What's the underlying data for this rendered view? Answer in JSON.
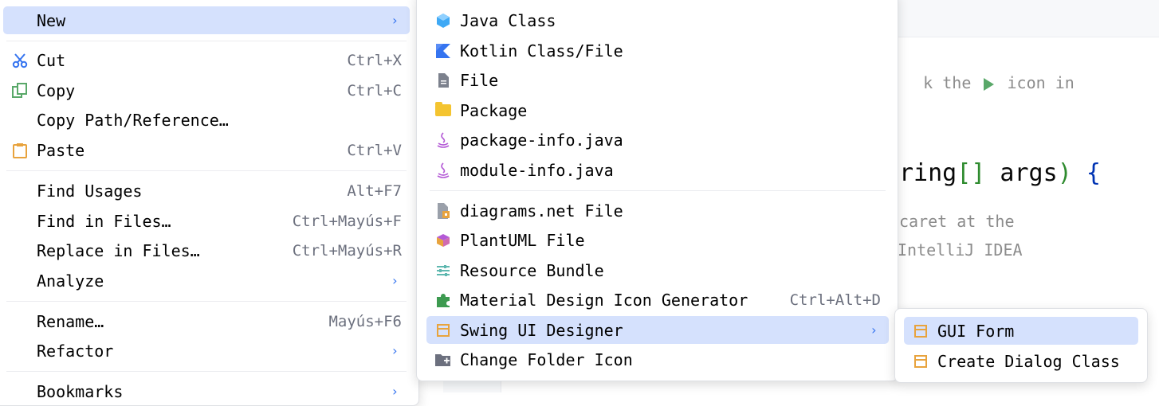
{
  "editor": {
    "line1_left": "k the",
    "line1_right": "icon in",
    "line2_text": "ring",
    "line2_brackets": "[]",
    "line2_args": " args",
    "line2_paren": ")",
    "line2_brace": "{",
    "line3": "caret at the",
    "line4": "IntelliJ IDEA",
    "right_paren": ")"
  },
  "main_menu": {
    "items": [
      {
        "label": "New",
        "shortcut": "",
        "has_submenu": true,
        "selected": true
      },
      {
        "label": "Cut",
        "shortcut": "Ctrl+X",
        "icon": "scissors-icon"
      },
      {
        "label": "Copy",
        "shortcut": "Ctrl+C",
        "icon": "copy-icon"
      },
      {
        "label": "Copy Path/Reference…",
        "shortcut": ""
      },
      {
        "label": "Paste",
        "shortcut": "Ctrl+V",
        "icon": "clipboard-icon"
      },
      {
        "label": "Find Usages",
        "shortcut": "Alt+F7"
      },
      {
        "label": "Find in Files…",
        "shortcut": "Ctrl+Mayús+F"
      },
      {
        "label": "Replace in Files…",
        "shortcut": "Ctrl+Mayús+R"
      },
      {
        "label": "Analyze",
        "shortcut": "",
        "has_submenu": true
      },
      {
        "label": "Rename…",
        "shortcut": "Mayús+F6"
      },
      {
        "label": "Refactor",
        "shortcut": "",
        "has_submenu": true
      },
      {
        "label": "Bookmarks",
        "shortcut": "",
        "has_submenu": true
      }
    ]
  },
  "new_menu": {
    "items": [
      {
        "label": "Java Class",
        "icon": "java-class-icon"
      },
      {
        "label": "Kotlin Class/File",
        "icon": "kotlin-icon"
      },
      {
        "label": "File",
        "icon": "file-icon"
      },
      {
        "label": "Package",
        "icon": "package-folder-icon"
      },
      {
        "label": "package-info.java",
        "icon": "java-file-icon"
      },
      {
        "label": "module-info.java",
        "icon": "java-file-icon"
      },
      {
        "label": "diagrams.net File",
        "icon": "diagrams-icon"
      },
      {
        "label": "PlantUML File",
        "icon": "plantuml-icon"
      },
      {
        "label": "Resource Bundle",
        "icon": "resource-bundle-icon"
      },
      {
        "label": "Material Design Icon Generator",
        "icon": "puzzle-icon",
        "shortcut": "Ctrl+Alt+D"
      },
      {
        "label": "Swing UI Designer",
        "icon": "swing-form-icon",
        "has_submenu": true,
        "selected": true
      },
      {
        "label": "Change Folder Icon",
        "icon": "folder-plus-icon"
      }
    ]
  },
  "swing_menu": {
    "items": [
      {
        "label": "GUI Form",
        "icon": "gui-form-icon",
        "selected": true
      },
      {
        "label": "Create Dialog Class",
        "icon": "dialog-class-icon"
      }
    ]
  },
  "symbols": {
    "submenu_arrow": "›"
  },
  "colors": {
    "selection": "#d5e1fd",
    "shortcut_text": "#6c707e",
    "arrow": "#3574f0"
  }
}
